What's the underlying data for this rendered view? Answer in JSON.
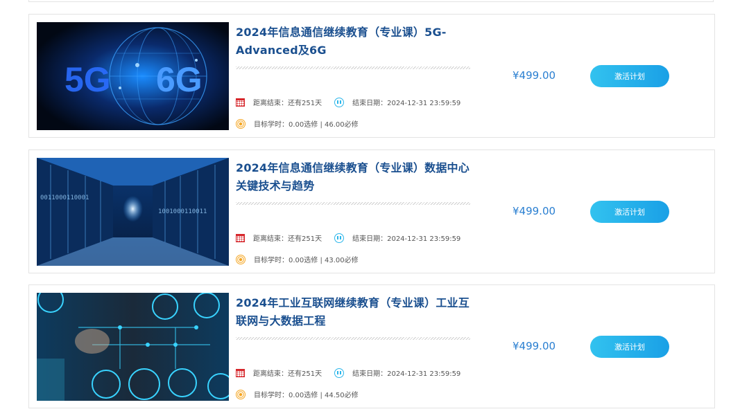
{
  "courses": [
    {
      "title": "2024年信息通信继续教育（专业课）5G-Advanced及6G",
      "image": "5g-6g-globe-image",
      "countdown_label": "距离结束：还有251天",
      "end_date_label": "结束日期：2024-12-31 23:59:59",
      "target_hours_label": "目标学时：0.00选修 | 46.00必修",
      "price": "¥499.00",
      "activate_label": "激活计划"
    },
    {
      "title": "2024年信息通信继续教育（专业课）数据中心关键技术与趋势",
      "image": "data-center-corridor-image",
      "countdown_label": "距离结束：还有251天",
      "end_date_label": "结束日期：2024-12-31 23:59:59",
      "target_hours_label": "目标学时：0.00选修 | 43.00必修",
      "price": "¥499.00",
      "activate_label": "激活计划"
    },
    {
      "title": "2024年工业互联网继续教育（专业课）工业互联网与大数据工程",
      "image": "industrial-internet-icons-image",
      "countdown_label": "距离结束：还有251天",
      "end_date_label": "结束日期：2024-12-31 23:59:59",
      "target_hours_label": "目标学时：0.00选修 | 44.50必修",
      "price": "¥499.00",
      "activate_label": "激活计划"
    }
  ],
  "colors": {
    "title": "#1a4f8f",
    "price": "#2a7fd1",
    "button": "#1aa0e6",
    "calendar_icon": "#d6262b",
    "clock_icon": "#2bb6ea",
    "target_icon": "#f5a623"
  }
}
